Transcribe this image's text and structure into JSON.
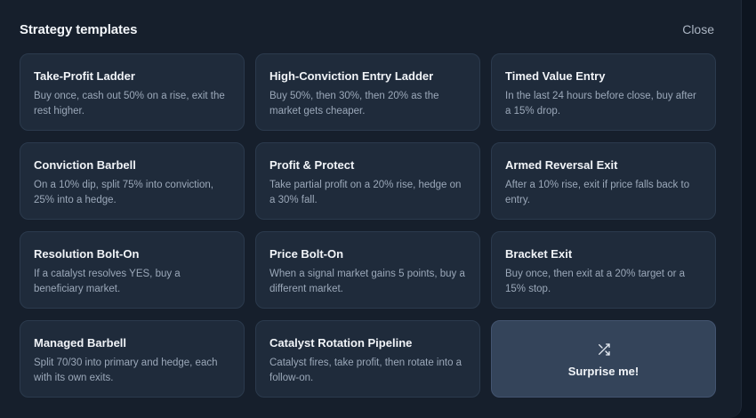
{
  "dialog": {
    "title": "Strategy templates",
    "close_label": "Close"
  },
  "templates": [
    {
      "title": "Take-Profit Ladder",
      "description": "Buy once, cash out 50% on a rise, exit the rest higher."
    },
    {
      "title": "High-Conviction Entry Ladder",
      "description": "Buy 50%, then 30%, then 20% as the market gets cheaper."
    },
    {
      "title": "Timed Value Entry",
      "description": "In the last 24 hours before close, buy after a 15% drop."
    },
    {
      "title": "Conviction Barbell",
      "description": "On a 10% dip, split 75% into conviction, 25% into a hedge."
    },
    {
      "title": "Profit & Protect",
      "description": "Take partial profit on a 20% rise, hedge on a 30% fall."
    },
    {
      "title": "Armed Reversal Exit",
      "description": "After a 10% rise, exit if price falls back to entry."
    },
    {
      "title": "Resolution Bolt-On",
      "description": "If a catalyst resolves YES, buy a beneficiary market."
    },
    {
      "title": "Price Bolt-On",
      "description": "When a signal market gains 5 points, buy a different market."
    },
    {
      "title": "Bracket Exit",
      "description": "Buy once, then exit at a 20% target or a 15% stop."
    },
    {
      "title": "Managed Barbell",
      "description": "Split 70/30 into primary and hedge, each with its own exits."
    },
    {
      "title": "Catalyst Rotation Pipeline",
      "description": "Catalyst fires, take profit, then rotate into a follow-on."
    }
  ],
  "surprise": {
    "label": "Surprise me!",
    "icon": "shuffle-icon"
  },
  "colors": {
    "background": "#0d1520",
    "panel": "#161f2c",
    "card": "#1f2b3b",
    "card_border": "#2b3a4d",
    "surprise_card": "#34445a",
    "title_text": "#f1f4f8",
    "desc_text": "#9ba8b9"
  }
}
